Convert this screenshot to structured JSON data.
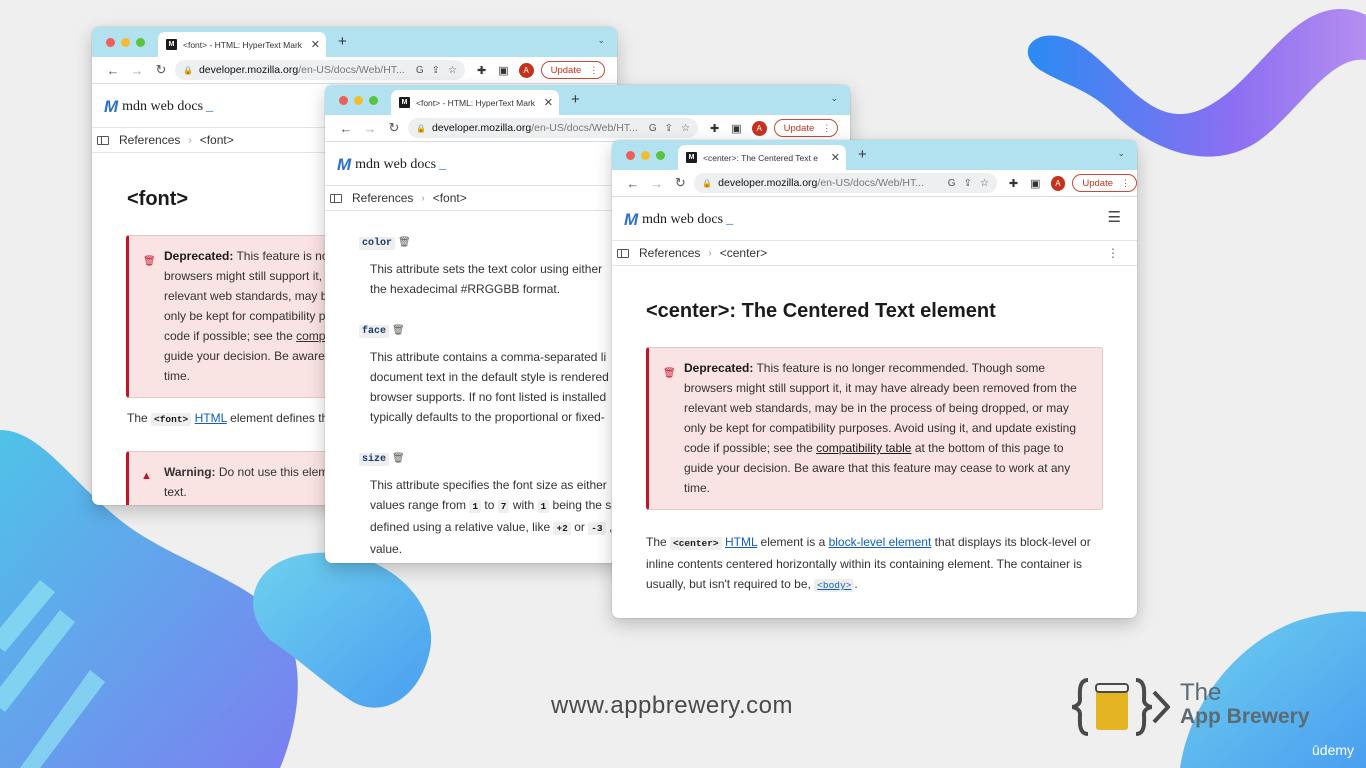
{
  "colors": {
    "accent_blue": "#2a6fd1",
    "deprecated_red": "#c3142a",
    "tabbar": "#b2e2f0",
    "update_red": "#c5331f"
  },
  "windows": {
    "w1": {
      "tab_title": "<font> - HTML: HyperText Mark",
      "url_host": "developer.mozilla.org",
      "url_path": "/en-US/docs/Web/HT...",
      "update": "Update",
      "avatar": "A",
      "logo": "mdn web docs",
      "breadcrumb": [
        "References",
        "<font>"
      ],
      "heading": "<font>",
      "deprecated_lines": [
        {
          "bold": "Deprecated:",
          "text": " This feature is no"
        },
        {
          "bold": "",
          "text": "browsers might still support it,"
        },
        {
          "bold": "",
          "text": "relevant web standards, may b"
        },
        {
          "bold": "",
          "text": "only be kept for compatibility p"
        },
        {
          "bold": "",
          "text": "code if possible; see the "
        },
        {
          "bold": "",
          "text": "guide your decision. Be aware"
        },
        {
          "bold": "",
          "text": "time."
        }
      ],
      "compat_link": "comp",
      "para_pre": "The ",
      "para_code": "<font>",
      "para_link": "HTML",
      "para_post": " element defines th",
      "warning_bold": "Warning:",
      "warning_text": " Do not use this elem",
      "warning_line2": "text."
    },
    "w2": {
      "tab_title": "<font> - HTML: HyperText Mark",
      "url_host": "developer.mozilla.org",
      "url_path": "/en-US/docs/Web/HT...",
      "update": "Update",
      "avatar": "A",
      "logo": "mdn web docs",
      "breadcrumb": [
        "References",
        "<font>"
      ],
      "attrs": [
        {
          "name": "color",
          "lines": [
            "This attribute sets the text color using either",
            "the hexadecimal #RRGGBB format."
          ]
        },
        {
          "name": "face",
          "lines": [
            "This attribute contains a comma-separated li",
            "document text in the default style is rendered",
            "browser supports. If no font listed is installed",
            "typically defaults to the proportional or fixed-"
          ]
        },
        {
          "name": "size",
          "lines": [
            "This attribute specifies the font size as either"
          ]
        }
      ],
      "size_l2": {
        "a": "values range from ",
        "c1": "1",
        "b": " to ",
        "c2": "7",
        "c": " with ",
        "c3": "1",
        "d": " being the s"
      },
      "size_l3": {
        "a": "defined using a relative value, like ",
        "c1": "+2",
        "b": " or ",
        "c2": "-3",
        "c": " ,"
      },
      "size_l4": "value."
    },
    "w3": {
      "tab_title": "<center>: The Centered Text e",
      "url_host": "developer.mozilla.org",
      "url_path": "/en-US/docs/Web/HT...",
      "update": "Update",
      "avatar": "A",
      "logo": "mdn web docs",
      "breadcrumb": [
        "References",
        "<center>"
      ],
      "heading": "<center>: The Centered Text element",
      "deprecated_bold": "Deprecated:",
      "deprecated_l1": " This feature is no longer recommended. Though some",
      "deprecated_lines": [
        "browsers might still support it, it may have already been removed from the",
        "relevant web standards, may be in the process of being dropped, or may",
        "only be kept for compatibility purposes. Avoid using it, and update existing"
      ],
      "deprecated_l5_pre": "code if possible; see the ",
      "compat_link": "compatibility table",
      "deprecated_l5_post": " at the bottom of this page to",
      "deprecated_l6": "guide your decision. Be aware that this feature may cease to work at any",
      "deprecated_l7": "time.",
      "para_pre": "The ",
      "para_code": "<center>",
      "para_link1": "HTML",
      "para_mid": " element is a ",
      "para_link2": "block-level element",
      "para_post": " that displays its block-level or",
      "para_l2": "inline contents centered horizontally within its containing element. The container is",
      "para_l3_pre": "usually, but isn't required to be, ",
      "para_l3_code": "<body>",
      "para_l3_post": "."
    }
  },
  "footer": {
    "site_url": "www.appbrewery.com",
    "brand_the": "The",
    "brand_name": "App Brewery",
    "udemy": "ūdemy"
  }
}
